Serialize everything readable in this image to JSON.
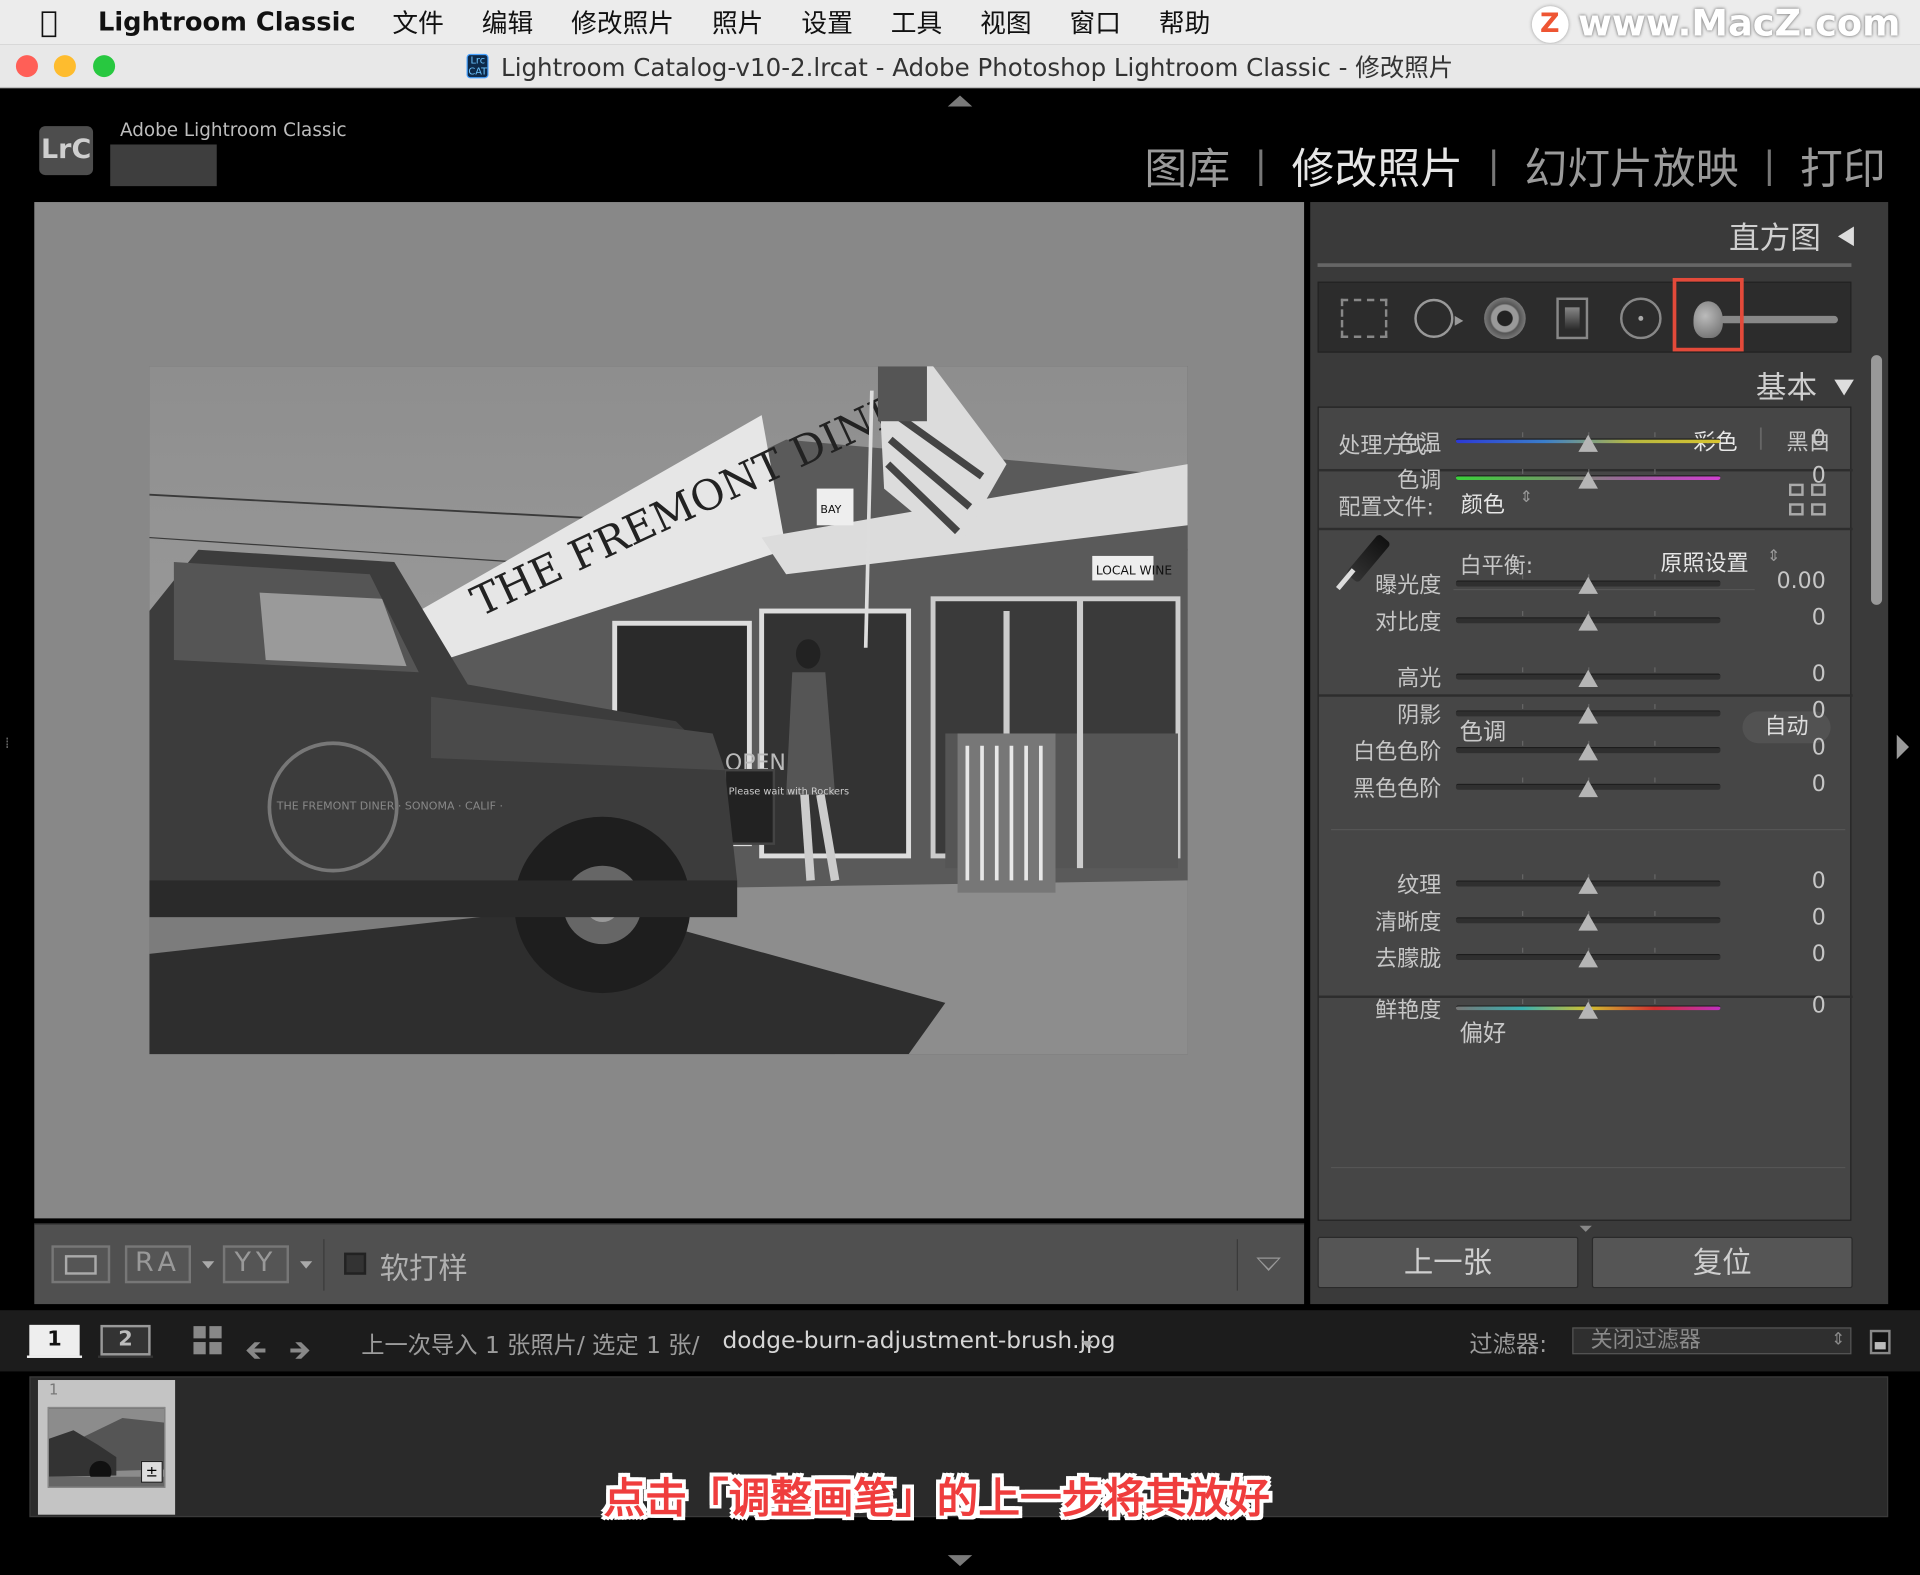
{
  "menubar": {
    "app_name": "Lightroom Classic",
    "items": [
      "文件",
      "编辑",
      "修改照片",
      "照片",
      "设置",
      "工具",
      "视图",
      "窗口",
      "帮助"
    ]
  },
  "watermark": {
    "logo": "Z",
    "text": "www.MacZ.com"
  },
  "window": {
    "title": "Lightroom Catalog-v10-2.lrcat - Adobe Photoshop Lightroom Classic - 修改照片",
    "doc_icon": "Lrc CAT"
  },
  "identity": {
    "logo": "LrC",
    "brand": "Adobe Lightroom Classic"
  },
  "modules": {
    "library": "图库",
    "develop": "修改照片",
    "slideshow": "幻灯片放映",
    "print": "打印",
    "separator": "|"
  },
  "toolbar": {
    "compare_ra": "RA",
    "compare_yy": "YY",
    "soft_proof": "软打样"
  },
  "right_panel": {
    "histogram_title": "直方图",
    "basic_title": "基本",
    "treatment_label": "处理方式:",
    "treatment_color": "彩色",
    "treatment_bw": "黑白",
    "treatment_sep": "|",
    "profile_label": "配置文件:",
    "profile_value": "颜色",
    "wb_label": "白平衡:",
    "wb_value": "原照设置",
    "tone_header": "色调",
    "auto": "自动",
    "presence_header": "偏好",
    "sliders": [
      {
        "label": "色温",
        "value": "0",
        "pos": 0.5
      },
      {
        "label": "色调",
        "value": "0",
        "pos": 0.5
      },
      {
        "label": "曝光度",
        "value": "0.00",
        "pos": 0.5
      },
      {
        "label": "对比度",
        "value": "0",
        "pos": 0.5
      },
      {
        "label": "高光",
        "value": "0",
        "pos": 0.5
      },
      {
        "label": "阴影",
        "value": "0",
        "pos": 0.5
      },
      {
        "label": "白色色阶",
        "value": "0",
        "pos": 0.5
      },
      {
        "label": "黑色色阶",
        "value": "0",
        "pos": 0.5
      },
      {
        "label": "纹理",
        "value": "0",
        "pos": 0.5
      },
      {
        "label": "清晰度",
        "value": "0",
        "pos": 0.5
      },
      {
        "label": "去朦胧",
        "value": "0",
        "pos": 0.5
      },
      {
        "label": "鲜艳度",
        "value": "0",
        "pos": 0.5
      }
    ],
    "prev_button": "上一张",
    "reset_button": "复位"
  },
  "filmstrip_bar": {
    "monitor1": "1",
    "monitor2": "2",
    "source": "上一次导入   1 张照片/ 选定 1 张/",
    "filename": "dodge-burn-adjustment-brush.jpg",
    "filter_label": "过滤器:",
    "filter_value": "关闭过滤器"
  },
  "filmstrip": {
    "index": "1"
  },
  "photo_signs": {
    "diner": "THE FREMONT DINER",
    "wine": "LOCAL WINE",
    "bay": "BAY",
    "open": "OPEN",
    "door_sign": "Please wait with Rockers",
    "truck_emblem": "THE FREMONT DINER · SONOMA · CALIF ·"
  },
  "caption": "点击「调整画笔」的上一步将其放好"
}
